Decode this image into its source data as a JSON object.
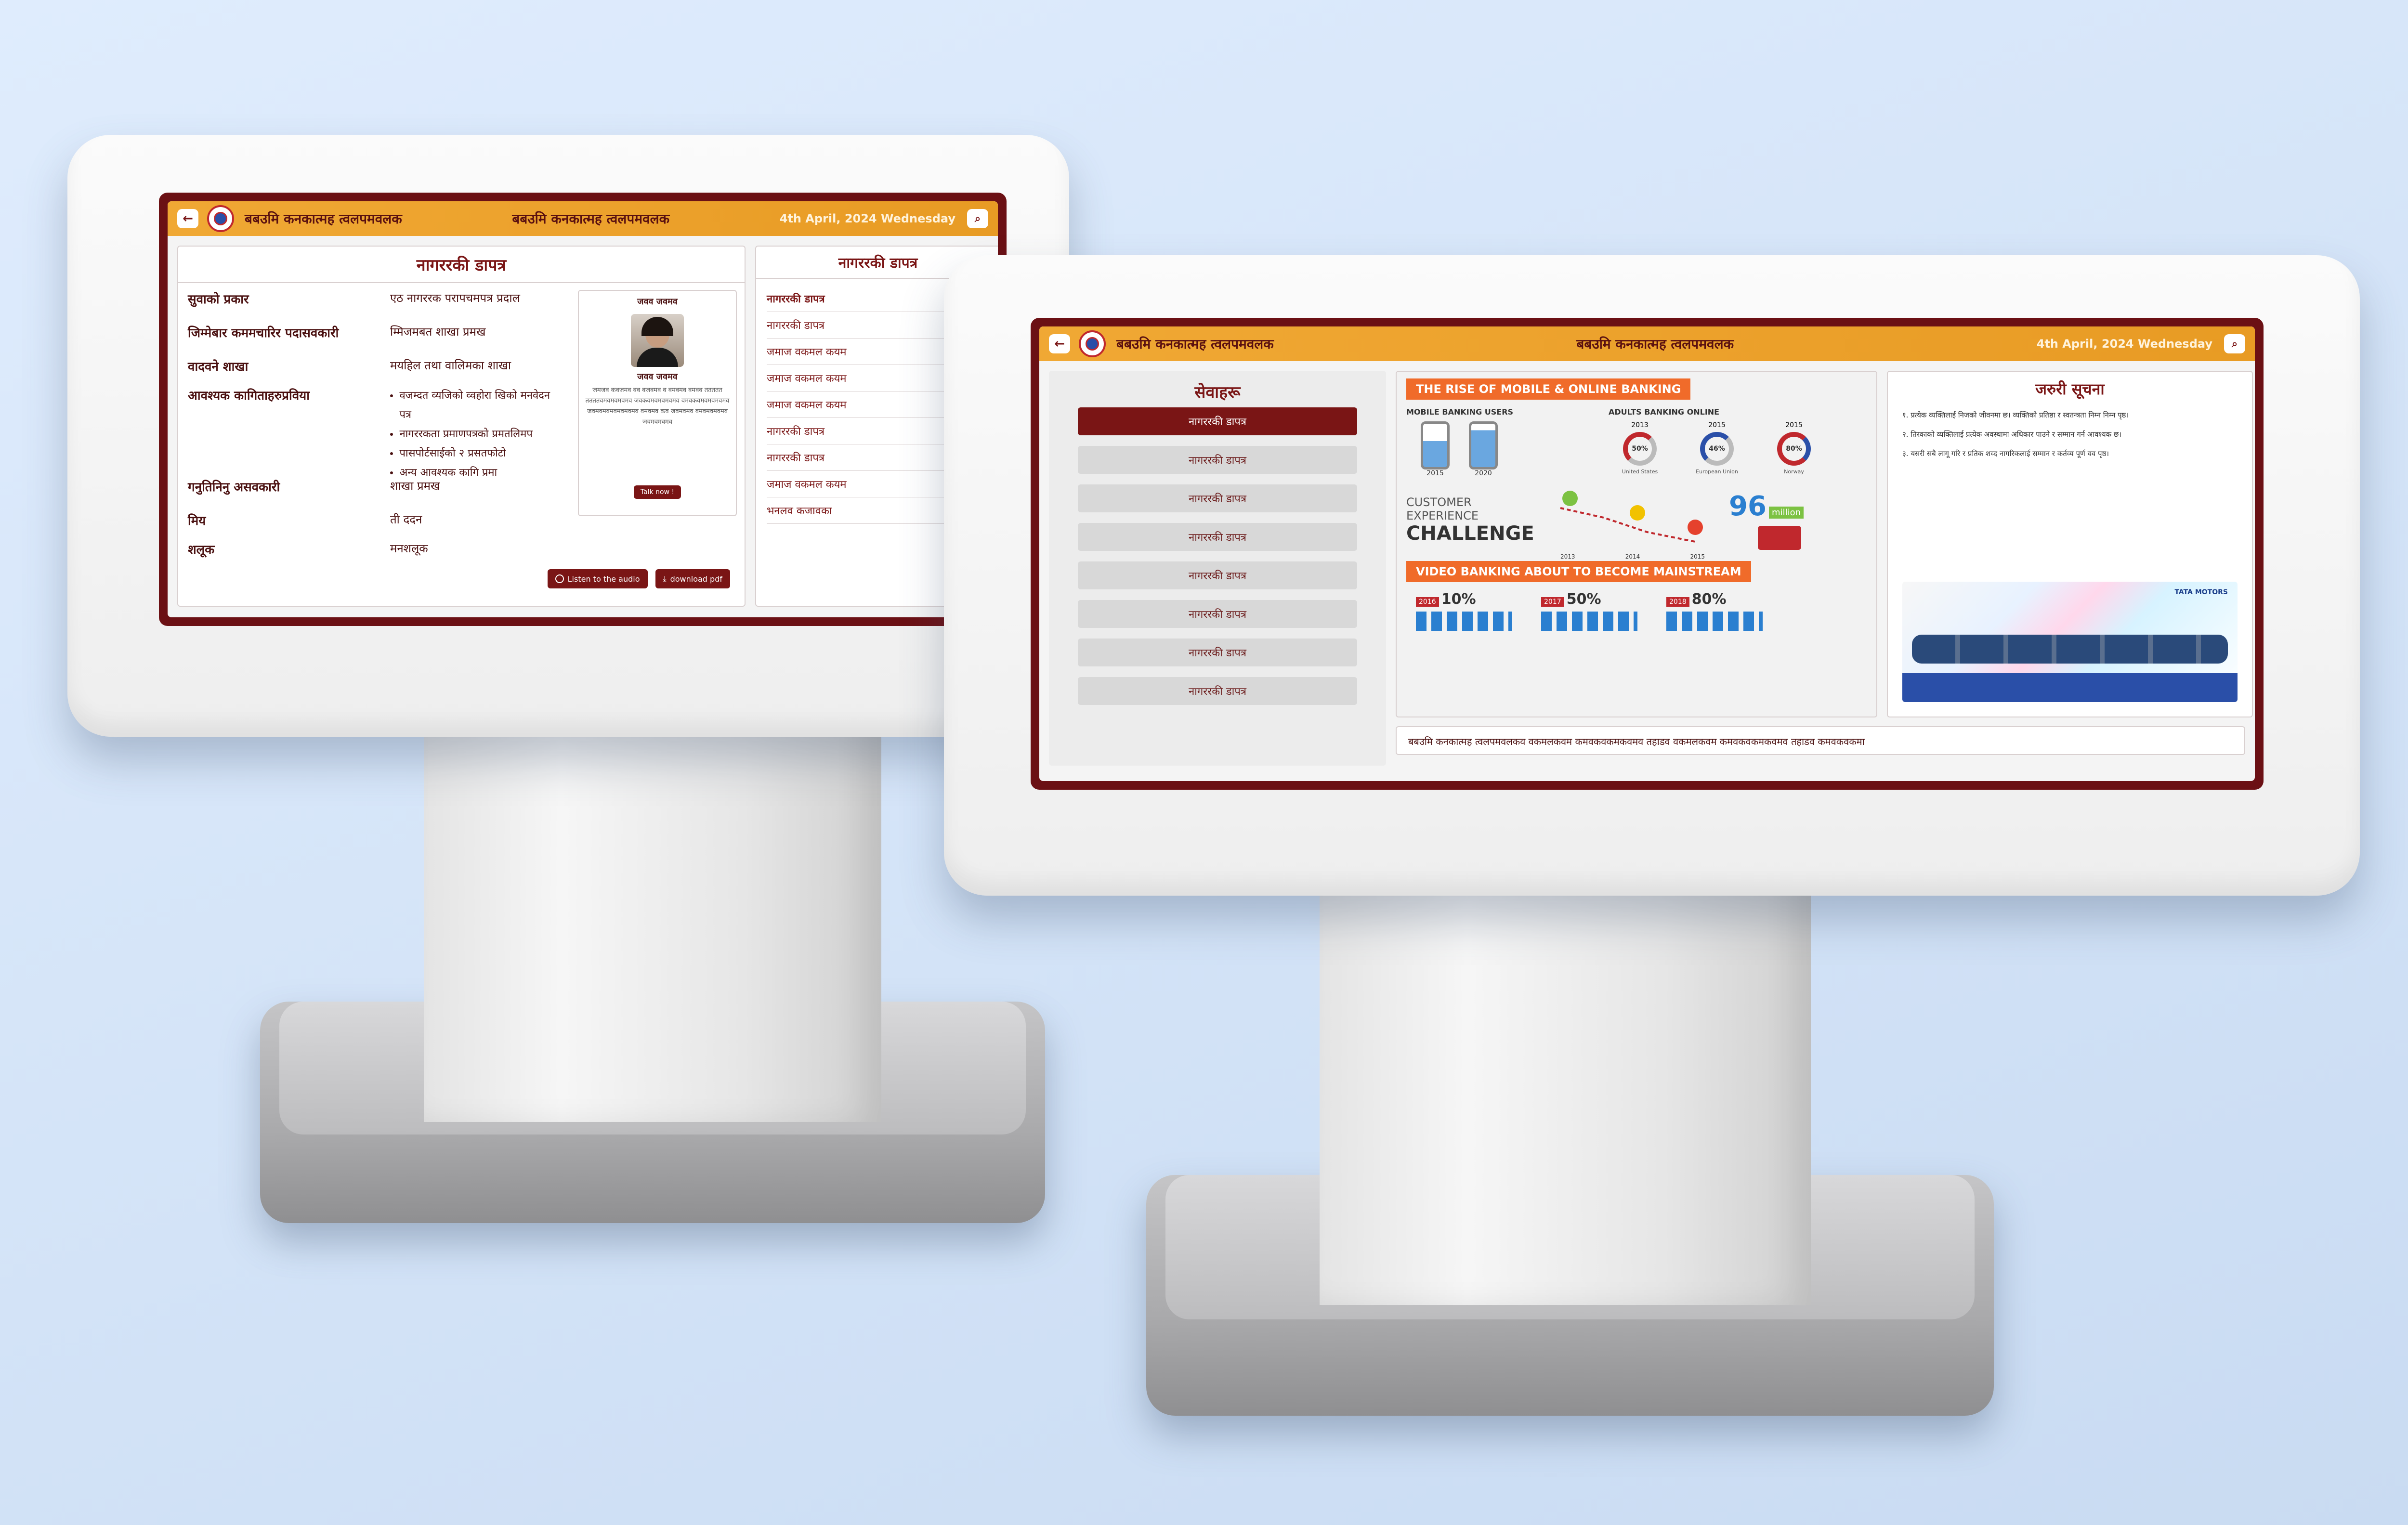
{
  "colors": {
    "header": "#e89b24",
    "frame": "#6b1014",
    "accent_red": "#7a1515",
    "ribbon_orange": "#f06b2a",
    "background": "#d8e7fb"
  },
  "left_kiosk": {
    "header": {
      "back_icon": "arrow-left-icon",
      "org_name": "बबउमि कनकात्मह त्वलपमवलक",
      "org_name_right": "बबउमि कनकात्मह त्वलपमवलक",
      "date": "4th April, 2024 Wednesday",
      "search_icon": "search-icon"
    },
    "main_panel": {
      "title": "नागररकी डापत्र",
      "rows": [
        {
          "label": "सुवाको प्रकार",
          "value": "एठ नागररक परापचमपत्र प्रदाल"
        },
        {
          "label": "जिम्मेबार कममचारिर पदासवकारी",
          "value": "म्मिजमबत शाखा प्रमख"
        },
        {
          "label": "वादवने शाखा",
          "value": "मयहिल तथा वालिमका शाखा"
        },
        {
          "label": "आवश्यक कागिताहरुप्रविया",
          "value": ""
        },
        {
          "label": "गनुतिनिनु असवकारी",
          "value": "शाखा प्रमख"
        },
        {
          "label": "मिय",
          "value": "ती ददन"
        },
        {
          "label": "शलूक",
          "value": "मनशलूक"
        }
      ],
      "bullets": [
        "वजम्दत व्यजिको व्वहोरा खिको मनवेदन पत्र",
        "नागररकता प्रमाणपत्रको प्रमतलिमप",
        "पासपोर्टसाईको २ प्रसतफोटो",
        "अन्य आवश्यक कागि प्रमा"
      ],
      "listen_button": "Listen to the audio",
      "download_button": "download pdf"
    },
    "profile_card": {
      "heading": "जवव जवमव",
      "name": "जवव जवमव",
      "description": "जमजव कवजमव वव वजवमव व वमवमव वमवव ततततत ततततवमवमवमवमव जवकवमवमवमवमव वमवकवमवमवमवमव जवमवमवमवमवमवमव वमवमव कव जवमवमव वमवमवमवमव जवमवमवमव",
      "button": "Talk now !"
    },
    "side_list": {
      "title": "नागररकी डापत्र",
      "items": [
        "नागररकी डापत्र",
        "नागररकी डापत्र",
        "जमाज वकमल कयम",
        "जमाज वकमल कयम",
        "जमाज वकमल कयम",
        "नागररकी डापत्र",
        "नागररकी डापत्र",
        "जमाज वकमल कयम",
        "भनलव कजावका"
      ]
    }
  },
  "right_kiosk": {
    "header": {
      "back_icon": "arrow-left-icon",
      "org_name": "बबउमि कनकात्मह त्वलपमवलक",
      "org_name_right": "बबउमि कनकात्मह त्वलपमवलक",
      "date": "4th April, 2024 Wednesday",
      "search_icon": "search-icon"
    },
    "services": {
      "title": "सेवाहरू",
      "items": [
        "नागररकी डापत्र",
        "नागररकी डापत्र",
        "नागररकी डापत्र",
        "नागररकी डापत्र",
        "नागररकी डापत्र",
        "नागररकी डापत्र",
        "नागररकी डापत्र",
        "नागररकी डापत्र"
      ]
    },
    "infographic": {
      "title1": "THE RISE OF MOBILE & ONLINE BANKING",
      "mobile_users_label": "MOBILE BANKING USERS",
      "adults_online_label": "ADULTS BANKING ONLINE",
      "years_phone": [
        "2015",
        "2020"
      ],
      "donuts": [
        {
          "year": "2013",
          "pct": "50%",
          "caption": "United States"
        },
        {
          "year": "2015",
          "pct": "46%",
          "caption": "European Union"
        },
        {
          "year": "2015",
          "pct": "80%",
          "caption": "Norway"
        }
      ],
      "cx_label_1": "CUSTOMER",
      "cx_label_2": "EXPERIENCE",
      "cx_label_3": "CHALLENGE",
      "cx_years": [
        "2013",
        "2014",
        "2015"
      ],
      "million_value": "96",
      "million_unit": "million",
      "title2": "VIDEO BANKING ABOUT TO BECOME MAINSTREAM",
      "video_stats": [
        {
          "year": "2016",
          "pct": "10%"
        },
        {
          "year": "2017",
          "pct": "50%"
        },
        {
          "year": "2018",
          "pct": "80%"
        }
      ]
    },
    "notice": {
      "title": "जरुरी सूचना",
      "lines": [
        "१. प्रत्येक व्यक्तिलाई निजको जीवनमा छ। व्यक्तिको प्रतिष्ठा र स्वतन्त्रता निम्न निम्न पृष्ठ।",
        "२. तिरकाको व्यक्तिलाई प्रत्येक अवस्थामा अधिकार पाउने र सम्मान गर्न आवश्यक छ।",
        "३. यसरी सबै लागू गरि र प्रतिक शव्द नागरिकलाई सम्मान र कर्तव्य पूर्ण वव पृष्ठ।"
      ],
      "promo_brand": "TATA MOTORS"
    },
    "ticker": "बबउमि कनकात्मह त्वलपमवलकव वकमलकवम कमवकवकमकवमव तहाडव वकमलकवम कमवकवकमकवमव तहाडव कमवकवकमा"
  }
}
